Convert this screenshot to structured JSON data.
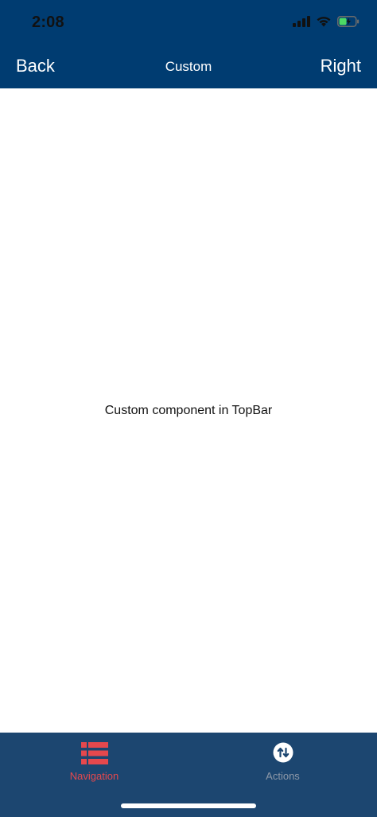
{
  "status_bar": {
    "time": "2:08",
    "icons": [
      "signal-icon",
      "wifi-icon",
      "battery-icon"
    ]
  },
  "top_bar": {
    "back_label": "Back",
    "title": "Custom",
    "right_label": "Right"
  },
  "main": {
    "message": "Custom component in TopBar"
  },
  "bottom_tabs": [
    {
      "label": "Navigation",
      "icon": "list-icon",
      "active": true
    },
    {
      "label": "Actions",
      "icon": "swap-arrows-icon",
      "active": false
    }
  ],
  "colors": {
    "header_bg": "#003C71",
    "tabbar_bg": "#1C4670",
    "active_tab": "#E5484D",
    "inactive_tab": "#8E99A8"
  }
}
